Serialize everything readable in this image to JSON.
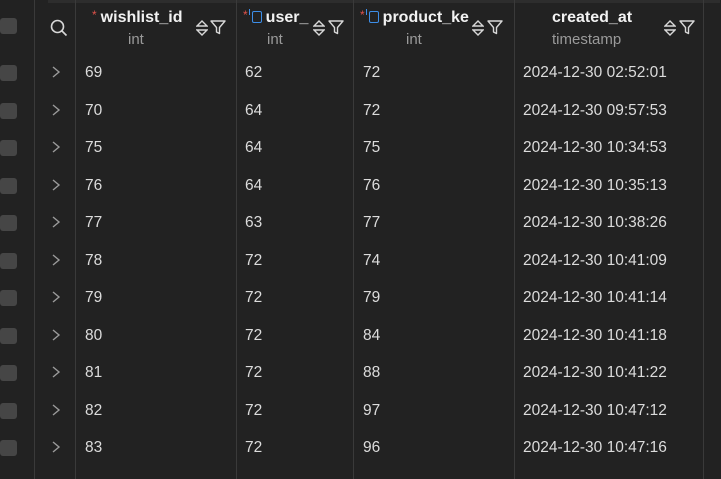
{
  "columns": [
    {
      "name": "wishlist_id",
      "type": "int",
      "required": true,
      "key": false
    },
    {
      "name": "user_",
      "type": "int",
      "required": true,
      "key": true
    },
    {
      "name": "product_ke",
      "type": "int",
      "required": true,
      "key": true
    },
    {
      "name": "created_at",
      "type": "timestamp",
      "required": false,
      "key": false
    }
  ],
  "required_marker": "*",
  "icons": {
    "search": "search-icon",
    "sort": "sort-icon",
    "filter": "filter-icon",
    "expand": "chevron-right-icon",
    "key": "foreign-key-icon"
  },
  "colors": {
    "background": "#222222",
    "required_star": "#e0524b",
    "key_icon": "#3d8ee8",
    "type_text": "#9a9a9a"
  },
  "rows": [
    {
      "wishlist_id": "69",
      "user_": "62",
      "product_ke": "72",
      "created_at": "2024-12-30 02:52:01"
    },
    {
      "wishlist_id": "70",
      "user_": "64",
      "product_ke": "72",
      "created_at": "2024-12-30 09:57:53"
    },
    {
      "wishlist_id": "75",
      "user_": "64",
      "product_ke": "75",
      "created_at": "2024-12-30 10:34:53"
    },
    {
      "wishlist_id": "76",
      "user_": "64",
      "product_ke": "76",
      "created_at": "2024-12-30 10:35:13"
    },
    {
      "wishlist_id": "77",
      "user_": "63",
      "product_ke": "77",
      "created_at": "2024-12-30 10:38:26"
    },
    {
      "wishlist_id": "78",
      "user_": "72",
      "product_ke": "74",
      "created_at": "2024-12-30 10:41:09"
    },
    {
      "wishlist_id": "79",
      "user_": "72",
      "product_ke": "79",
      "created_at": "2024-12-30 10:41:14"
    },
    {
      "wishlist_id": "80",
      "user_": "72",
      "product_ke": "84",
      "created_at": "2024-12-30 10:41:18"
    },
    {
      "wishlist_id": "81",
      "user_": "72",
      "product_ke": "88",
      "created_at": "2024-12-30 10:41:22"
    },
    {
      "wishlist_id": "82",
      "user_": "72",
      "product_ke": "97",
      "created_at": "2024-12-30 10:47:12"
    },
    {
      "wishlist_id": "83",
      "user_": "72",
      "product_ke": "96",
      "created_at": "2024-12-30 10:47:16"
    }
  ]
}
